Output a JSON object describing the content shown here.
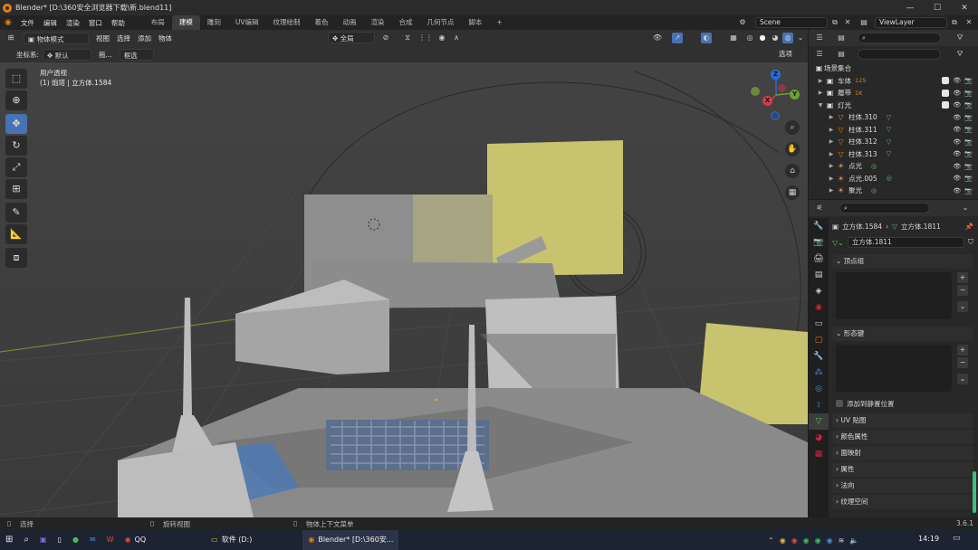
{
  "titlebar": {
    "title": "Blender* [D:\\360安全浏览器下载\\新.blend11]"
  },
  "menubar": {
    "menus": [
      "文件",
      "编辑",
      "渲染",
      "窗口",
      "帮助"
    ],
    "workspaces": [
      "布局",
      "建模",
      "雕刻",
      "UV编辑",
      "纹理绘制",
      "着色",
      "动画",
      "渲染",
      "合成",
      "几何节点",
      "脚本"
    ],
    "active_workspace": "建模",
    "add_tab": "+",
    "scene": "Scene",
    "view_layer": "ViewLayer"
  },
  "header1": {
    "mode": "物体模式",
    "menus": [
      "视图",
      "选择",
      "添加",
      "物体"
    ],
    "transform_orientation": "全局"
  },
  "header2": {
    "coord_label": "坐标系:",
    "coord_value": "默认",
    "drag_label": "拖...",
    "select_mode": "框选",
    "options": "选项"
  },
  "viewport": {
    "view_name": "用户透视",
    "object_info": "(1) 炮塔 | 立方体.1584",
    "gizmo": {
      "x": "X",
      "y": "Y",
      "z": "Z"
    }
  },
  "outliner": {
    "root": "场景集合",
    "rows": [
      {
        "name": "车体",
        "badge": "125",
        "level": 1,
        "arrow": "▶"
      },
      {
        "name": "履带",
        "badge": "1K",
        "level": 1,
        "arrow": "▶"
      },
      {
        "name": "灯光",
        "badge": "",
        "level": 1,
        "arrow": "▼"
      },
      {
        "name": "柱体.310",
        "badge": "",
        "level": 2,
        "arrow": "▶"
      },
      {
        "name": "柱体.311",
        "badge": "",
        "level": 2,
        "arrow": "▶"
      },
      {
        "name": "柱体.312",
        "badge": "",
        "level": 2,
        "arrow": "▶"
      },
      {
        "name": "柱体.313",
        "badge": "",
        "level": 2,
        "arrow": "▶"
      },
      {
        "name": "点光",
        "badge": "",
        "level": 2,
        "arrow": "▶"
      },
      {
        "name": "点光.005",
        "badge": "",
        "level": 2,
        "arrow": "▶"
      },
      {
        "name": "聚光",
        "badge": "",
        "level": 2,
        "arrow": "▶"
      }
    ]
  },
  "properties": {
    "breadcrumb_object": "立方体.1584",
    "breadcrumb_data": "立方体.1811",
    "data_name": "立方体.1811",
    "panels": {
      "vertex_groups": "顶点组",
      "shape_keys": "形态键",
      "relative_checkbox": "添加到静置位置",
      "uv_maps": "UV 贴图",
      "color_attributes": "颜色属性",
      "face_maps": "面映射",
      "attributes": "属性",
      "normals": "法向",
      "texture_space": "纹理空间"
    }
  },
  "statusbar": {
    "left": "选择",
    "middle": "旋转视图",
    "right": "物体上下文菜单",
    "version": "3.6.1"
  },
  "taskbar": {
    "qq": "QQ",
    "explorer": "软件 (D:)",
    "blender": "Blender* [D:\\360安...",
    "time": "14:19"
  }
}
